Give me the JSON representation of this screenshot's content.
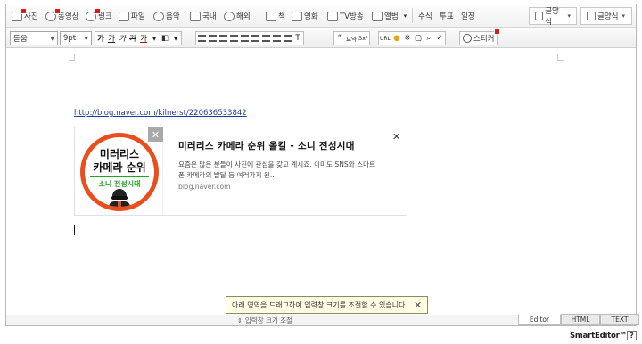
{
  "toolbar_insert": {
    "items": [
      {
        "label": "사진",
        "icon": "photo-icon",
        "badge": true
      },
      {
        "label": "동영상",
        "icon": "video-icon",
        "badge": true
      },
      {
        "label": "링크",
        "icon": "link-icon",
        "badge": true
      },
      {
        "label": "파일",
        "icon": "file-icon",
        "badge": false
      },
      {
        "label": "음악",
        "icon": "music-icon",
        "badge": false
      },
      {
        "label": "국내",
        "icon": "map-icon",
        "badge": false
      },
      {
        "label": "해외",
        "icon": "globe-icon",
        "badge": false
      },
      {
        "label": "책",
        "icon": "book-icon",
        "badge": false
      },
      {
        "label": "영화",
        "icon": "movie-icon",
        "badge": false
      },
      {
        "label": "TV방송",
        "icon": "tv-icon",
        "badge": false
      },
      {
        "label": "앨범",
        "icon": "album-icon",
        "badge": false
      },
      {
        "label": "수식",
        "icon": "",
        "badge": false
      },
      {
        "label": "투표",
        "icon": "",
        "badge": false
      },
      {
        "label": "일정",
        "icon": "",
        "badge": false
      }
    ],
    "right_buttons": [
      {
        "label": "글양식",
        "icon": "template-icon"
      },
      {
        "label": "글양식",
        "icon": "table-template-icon"
      }
    ]
  },
  "toolbar_format": {
    "font": "돋움",
    "size": "9pt",
    "buttons": [
      "가",
      "가",
      "가",
      "가",
      "가"
    ],
    "misc": [
      "“",
      "요약",
      "3x³",
      "URL"
    ],
    "sticker": "스티커"
  },
  "editor": {
    "link_url": "http://blog.naver.com/kilnerst/220636533842",
    "og_card": {
      "thumb_line1": "미러리스",
      "thumb_line2": "카메라 순위",
      "thumb_line3": "소니 전성시대",
      "title": "미러리스 카메라 순위 올킬 - 소니 전성시대",
      "description": "요즘은 많은 분들이 사진에 관심을 갖고 계시죠. 이미도 SNS와 스마트폰 카메라의 발달 등 여러가지 원..",
      "domain": "blog.naver.com",
      "close": "✕"
    }
  },
  "tooltip": {
    "text": "아래 영역을 드래그하여 입력창 크기를 조절할 수 있습니다.",
    "close": "✕"
  },
  "resize_label": "입력창 크기 조절",
  "modes": [
    {
      "label": "Editor",
      "active": true
    },
    {
      "label": "HTML",
      "active": false
    },
    {
      "label": "TEXT",
      "active": false
    }
  ],
  "brand": "SmartEditor™",
  "help": "?"
}
